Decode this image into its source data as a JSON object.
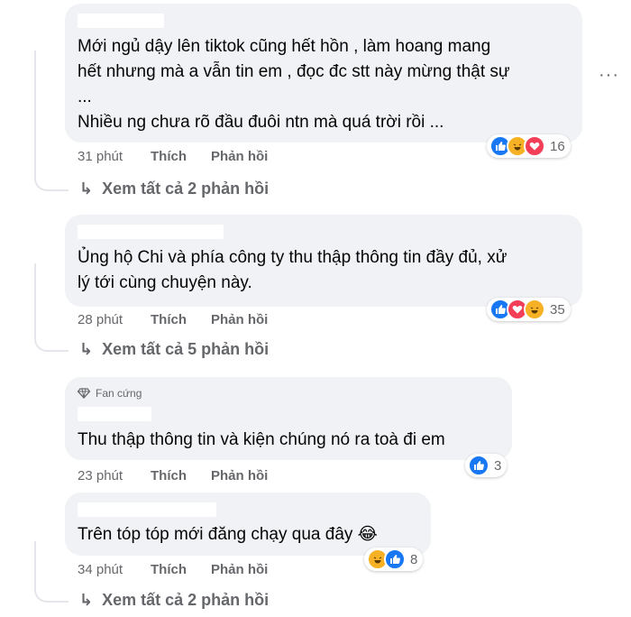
{
  "comments": [
    {
      "text": "Mới ngủ dậy lên tiktok cũng hết hồn , làm hoang mang\nhết nhưng mà a vẫn tin em , đọc đc stt này mừng thật sự\n...\nNhiều ng chưa rõ đầu đuôi ntn mà quá trời rồi ...",
      "time": "31 phút",
      "like_label": "Thích",
      "reply_label": "Phản hồi",
      "reactions": [
        "like",
        "haha",
        "love"
      ],
      "reaction_count": "16",
      "view_replies": "Xem tất cả 2 phản hồi"
    },
    {
      "text": "Ủng hộ Chi và phía công ty thu thập thông tin đầy đủ, xử\nlý tới cùng chuyện này.",
      "time": "28 phút",
      "like_label": "Thích",
      "reply_label": "Phản hồi",
      "reactions": [
        "like",
        "love",
        "haha"
      ],
      "reaction_count": "35",
      "view_replies": "Xem tất cả 5 phản hồi"
    },
    {
      "badge": "Fan cứng",
      "text": "Thu thập thông tin và kiện chúng nó ra toà đi em",
      "time": "23 phút",
      "like_label": "Thích",
      "reply_label": "Phản hồi",
      "reactions": [
        "like"
      ],
      "reaction_count": "3"
    },
    {
      "text": "Trên tóp tóp mới đăng chạy qua đây 😂",
      "time": "34 phút",
      "like_label": "Thích",
      "reply_label": "Phản hồi",
      "reactions": [
        "haha",
        "like"
      ],
      "reaction_count": "8",
      "view_replies": "Xem tất cả 2 phản hồi"
    }
  ],
  "more_options": "···",
  "colors": {
    "like": "#1877f2",
    "love": "#f33e58",
    "haha": "#f7b125",
    "meta": "#65676b",
    "bubble": "#f0f2f5"
  },
  "icons": {
    "like": "thumbs-up-icon",
    "love": "heart-icon",
    "haha": "laughing-face-icon",
    "badge": "diamond-icon",
    "reply_arrow": "reply-arrow-icon"
  }
}
